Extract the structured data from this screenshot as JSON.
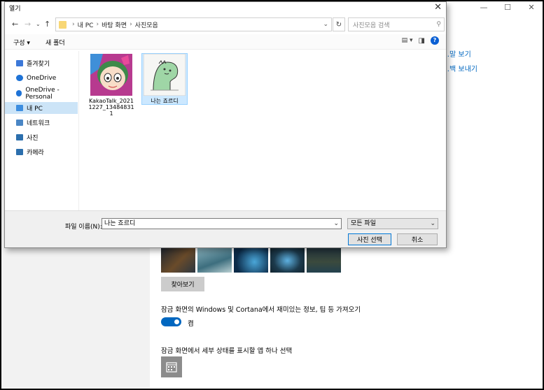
{
  "settings": {
    "links": [
      "…말 보기",
      "…백 보내기"
    ],
    "browse_label": "찾아보기",
    "lock_info_label": "잠금 화면의 Windows 및 Cortana에서 재미있는 정보, 팁 등 가져오기",
    "toggle_state": "켬",
    "detail_label": "잠금 화면에서 세부 상태를 표시할 앱 하나 선택"
  },
  "dialog": {
    "title": "열기",
    "breadcrumb": [
      "내 PC",
      "바탕 화면",
      "사진모음"
    ],
    "search_placeholder": "사진모음 검색",
    "toolbar": {
      "organize": "구성 ▾",
      "new_folder": "새 폴더",
      "help": "?"
    },
    "nav_items": [
      {
        "label": "즐겨찾기",
        "icon": "star-icon"
      },
      {
        "label": "OneDrive",
        "icon": "cloud-icon"
      },
      {
        "label": "OneDrive - Personal",
        "icon": "cloud-icon"
      },
      {
        "label": "내 PC",
        "icon": "computer-icon",
        "selected": true
      },
      {
        "label": "네트워크",
        "icon": "network-icon"
      },
      {
        "label": "사진",
        "icon": "pictures-icon"
      },
      {
        "label": "카메라",
        "icon": "camera-icon"
      }
    ],
    "files": [
      {
        "name": "KakaoTalk_20211227_134848311",
        "selected": false
      },
      {
        "name": "나는 죠르디",
        "selected": true
      }
    ],
    "filename_label": "파일 이름(N):",
    "filename_value": "나는 죠르디",
    "filter_value": "모든 파일",
    "select_label": "사진 선택",
    "cancel_label": "취소"
  },
  "colors": {
    "accent": "#0067c0",
    "selection": "#cce8ff",
    "folder": "#f8d775"
  }
}
